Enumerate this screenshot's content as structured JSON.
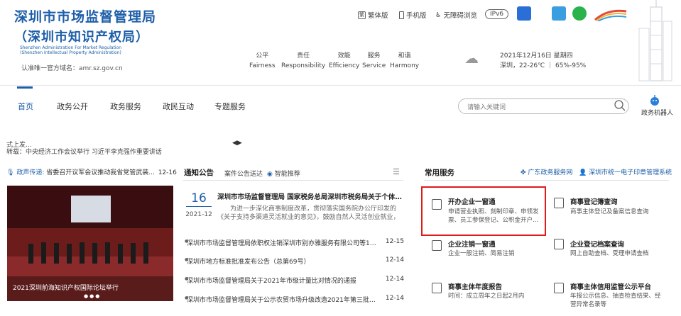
{
  "header": {
    "title_line1": "深圳市市场监督管理局",
    "title_line2": "（深圳市知识产权局）",
    "english_line1": "Shenzhen Administration For Market Regulation",
    "english_line2": "(Shenzhen Intellectual Property Administration)",
    "domain": "认准唯一官方域名：amr.sz.gov.cn",
    "topbar": {
      "traditional": "繁体版",
      "mobile": "手机版",
      "accessible": "无障碍浏览",
      "ipv6": "IPv6"
    },
    "values": [
      {
        "cn": "公平",
        "en": "Fairness"
      },
      {
        "cn": "责任",
        "en": "Responsibility"
      },
      {
        "cn": "效能",
        "en": "Efficiency"
      },
      {
        "cn": "服务",
        "en": "Service"
      },
      {
        "cn": "和谐",
        "en": "Harmony"
      }
    ],
    "weather": {
      "date": "2021年12月16日 星期四",
      "detail": "深圳，22-26℃ ｜ 65%-95%"
    }
  },
  "nav": {
    "items": [
      "首页",
      "政务公开",
      "政务服务",
      "政民互动",
      "专题服务"
    ],
    "search_placeholder": "请输入关键词",
    "robot": "政务机器人"
  },
  "left": {
    "scroll_line1": "式上发...",
    "scroll_line2": "转载：中央经济工作会议举行 习近平李克强作重要讲话",
    "ticker_label": "政声传递:",
    "ticker_text": "省委召开议军会议推动我省党管武装...",
    "ticker_date": "12-16",
    "photo_caption": "2021深圳前海知识产权国际论坛举行"
  },
  "notice": {
    "tab_main": "通知公告",
    "tab_sub1": "案件公告送达",
    "tab_sub2": "智能推荐",
    "featured": {
      "day": "16",
      "month": "2021-12",
      "title": "深圳市市场监督管理局 国家税务总局深圳市税务局关于个体工商户...",
      "summary": "为进一步深化商事制度改革，贯彻落实国务院办公厅印发的《关于支持多渠道灵活就业的意见》，鼓励自然人灵活创业就业，依据《深..."
    },
    "list": [
      {
        "text": "深圳市市场监督管理局依职权注销深圳市别亦雅服务有限公司等114家...",
        "date": "12-15"
      },
      {
        "text": "深圳市地方标准批准发布公告（总第69号）",
        "date": "12-14"
      },
      {
        "text": "深圳市市场监督管理局关于2021年市级计量比对情况的通报",
        "date": "12-14"
      },
      {
        "text": "深圳市市场监督管理局关于公示农贸市场升级改造2021年第三批专项...",
        "date": "12-14"
      }
    ]
  },
  "services": {
    "title": "常用服务",
    "link1": "广东政务服务网",
    "link2": "深圳市统一电子印章管理系统",
    "items": [
      {
        "name": "开办企业一窗通",
        "desc1": "申请营业执照、刻制印章、申领发",
        "desc2": "票、员工参保登记、公积金开户..."
      },
      {
        "name": "商事登记簿查询",
        "desc1": "商事主体登记及备案信息查询",
        "desc2": ""
      },
      {
        "name": "企业注销一窗通",
        "desc1": "企业一般注销、简易注销",
        "desc2": ""
      },
      {
        "name": "企业登记档案查询",
        "desc1": "网上自助查档、受理申请查档",
        "desc2": ""
      },
      {
        "name": "商事主体年度报告",
        "desc1": "时间：成立周年之日起2月内",
        "desc2": ""
      },
      {
        "name": "商事主体信用监管公示平台",
        "desc1": "年报公示信息、抽查检查结果、经",
        "desc2": "营异常名录等"
      }
    ]
  }
}
